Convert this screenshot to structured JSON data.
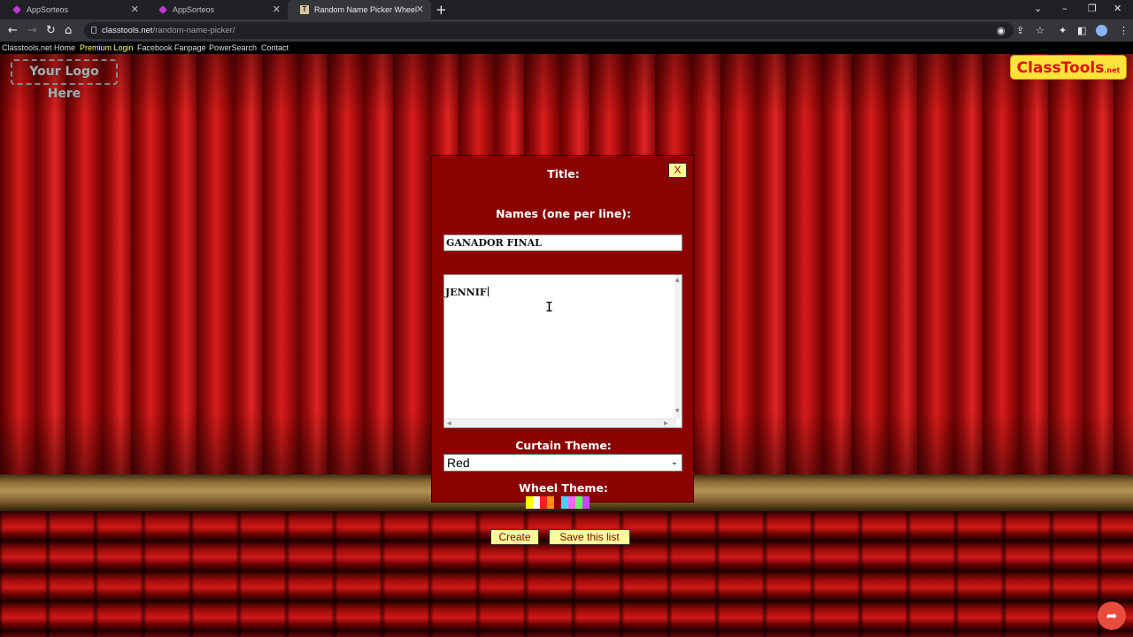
{
  "browser": {
    "tabs": [
      {
        "label": "AppSorteos"
      },
      {
        "label": "AppSorteos"
      },
      {
        "label": "Random Name Picker Wheel",
        "favicon": "T"
      }
    ],
    "url_host": "classtools.net",
    "url_path": "/random-name-picker/"
  },
  "sitenav": {
    "home": "Classtools.net Home",
    "premium": "Premium Login",
    "facebook": "Facebook Fanpage",
    "powersearch": "PowerSearch",
    "contact": "Contact"
  },
  "logo_placeholder": "Your Logo Here",
  "brand_logo": {
    "text": "ClassTools",
    "suffix": ".net"
  },
  "dialog": {
    "close_label": "X",
    "title_label": "Title:",
    "title_value": "GANADOR FINAL",
    "names_label": "Names (one per line):",
    "names_value": "JENNIF",
    "curtain_label": "Curtain Theme:",
    "curtain_value": "Red",
    "wheel_label": "Wheel Theme:",
    "wheel_swatches": [
      "#ffff00",
      "#ffffff",
      "#ff2020",
      "#ff8c1a",
      "#8b0000",
      "#4dd0ff",
      "#ff66ff",
      "#66ff66",
      "#cc44ff"
    ],
    "create_label": "Create",
    "save_label": "Save this list"
  },
  "colors": {
    "dialog_bg": "#8b0000",
    "button_bg": "#ffff99",
    "share_button": "#e84c3d"
  }
}
